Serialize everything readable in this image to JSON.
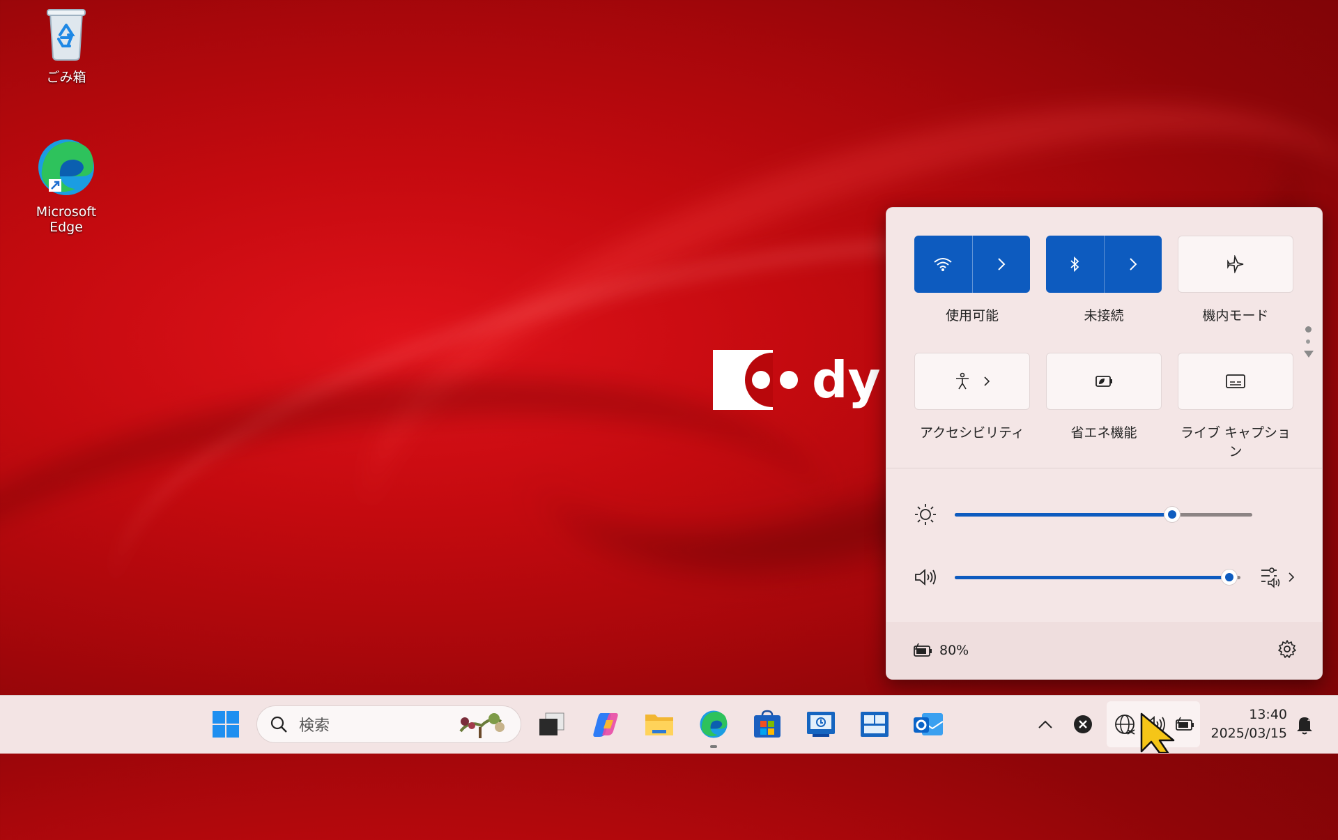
{
  "desktop": {
    "icons": [
      {
        "label": "ごみ箱",
        "icon": "recycle-bin-icon"
      },
      {
        "label": "Microsoft Edge",
        "icon": "edge-icon"
      }
    ],
    "wallpaper_logo_text": "dy"
  },
  "quick_settings": {
    "tiles": [
      {
        "label": "使用可能",
        "icon": "wifi-icon",
        "state": "on",
        "expandable": true
      },
      {
        "label": "未接続",
        "icon": "bluetooth-icon",
        "state": "on",
        "expandable": true
      },
      {
        "label": "機内モード",
        "icon": "airplane-icon",
        "state": "off",
        "expandable": false
      },
      {
        "label": "アクセシビリティ",
        "icon": "accessibility-icon",
        "state": "off",
        "expandable": true
      },
      {
        "label": "省エネ機能",
        "icon": "energy-saver-icon",
        "state": "off",
        "expandable": false
      },
      {
        "label": "ライブ キャプション",
        "icon": "live-captions-icon",
        "state": "off",
        "expandable": false
      }
    ],
    "brightness": {
      "value": 0.73,
      "icon": "brightness-icon"
    },
    "volume": {
      "value": 0.96,
      "icon": "speaker-icon"
    },
    "battery": {
      "percent_text": "80%",
      "icon": "battery-charging-icon"
    },
    "accent_color": "#0d5bbf"
  },
  "taskbar": {
    "search_placeholder": "検索",
    "apps": [
      "start-icon",
      "task-view-icon",
      "copilot-icon",
      "file-explorer-icon",
      "edge-icon",
      "store-icon",
      "app-icon",
      "widgets-app-icon",
      "outlook-icon"
    ],
    "clock": {
      "time": "13:40",
      "date": "2025/03/15"
    }
  }
}
